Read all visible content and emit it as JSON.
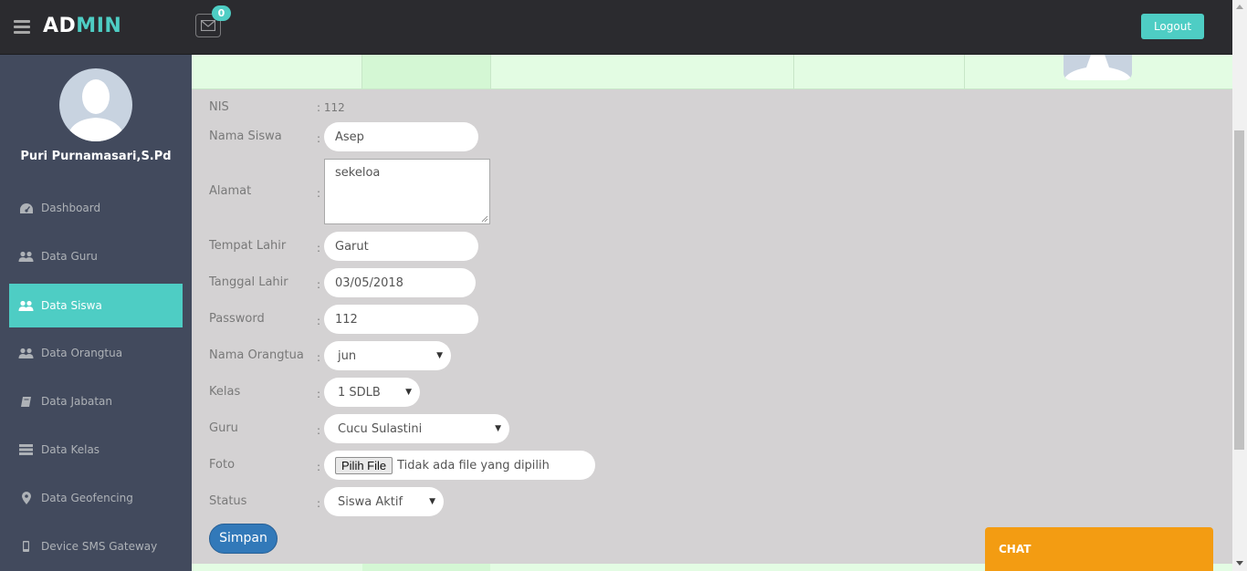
{
  "header": {
    "brand_part1": "AD",
    "brand_part2": "MIN",
    "mail_count": "0",
    "logout_label": "Logout"
  },
  "sidebar": {
    "user_name": "Puri Purnamasari,S.Pd",
    "items": [
      {
        "label": "Dashboard",
        "icon": "dashboard-icon"
      },
      {
        "label": "Data Guru",
        "icon": "users-icon"
      },
      {
        "label": "Data Siswa",
        "icon": "users-icon",
        "active": true
      },
      {
        "label": "Data Orangtua",
        "icon": "users-icon"
      },
      {
        "label": "Data Jabatan",
        "icon": "book-icon"
      },
      {
        "label": "Data Kelas",
        "icon": "server-icon"
      },
      {
        "label": "Data Geofencing",
        "icon": "map-marker-icon"
      },
      {
        "label": "Device SMS Gateway",
        "icon": "mobile-icon"
      }
    ]
  },
  "form": {
    "nis_label": "NIS",
    "nis_value": ": 112",
    "colon": ":",
    "nama_label": "Nama Siswa",
    "nama_value": "Asep",
    "alamat_label": "Alamat",
    "alamat_value": "sekeloa",
    "tempat_label": "Tempat Lahir",
    "tempat_value": "Garut",
    "tanggal_label": "Tanggal Lahir",
    "tanggal_value": "03/05/2018",
    "password_label": "Password",
    "password_value": "112",
    "orangtua_label": "Nama Orangtua",
    "orangtua_value": "jun",
    "kelas_label": "Kelas",
    "kelas_value": "1 SDLB",
    "guru_label": "Guru",
    "guru_value": "Cucu Sulastini",
    "foto_label": "Foto",
    "file_button": "Pilih File",
    "file_status": "Tidak ada file yang dipilih",
    "status_label": "Status",
    "status_value": "Siswa Aktif",
    "submit_label": "Simpan"
  },
  "chat": {
    "label": "CHAT"
  },
  "colors": {
    "accent": "#4ecdc4",
    "sidebar": "#424a5d",
    "topbar": "#2b2b2f",
    "chat": "#f39c12",
    "primary_button": "#3279b9"
  }
}
